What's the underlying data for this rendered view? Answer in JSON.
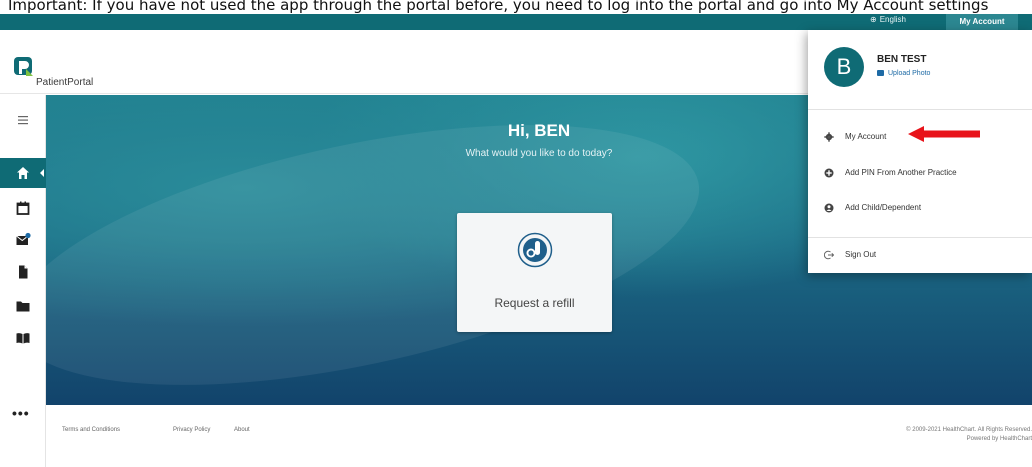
{
  "top_caption": "Important: If you have not used the app through the portal before, you need to log into the portal and go into My Account settings",
  "utility_bar": {
    "language": "English",
    "my_account": "My Account"
  },
  "brand": {
    "name": "PatientPortal"
  },
  "sidebar": {
    "items": [
      {
        "icon": "menu-icon"
      },
      {
        "icon": "home-icon",
        "active": true
      },
      {
        "icon": "calendar-icon"
      },
      {
        "icon": "mail-icon",
        "badge": true
      },
      {
        "icon": "document-icon"
      },
      {
        "icon": "folder-icon"
      },
      {
        "icon": "book-icon"
      }
    ],
    "more": "•••"
  },
  "hero": {
    "greeting": "Hi, BEN",
    "subtitle": "What would you like to do today?",
    "card_label": "Request a refill"
  },
  "footer": {
    "links": [
      "Terms and Conditions",
      "Privacy Policy",
      "About"
    ],
    "copyright": "© 2009-2021 HealthChart. All Rights Reserved.",
    "powered": "Powered by HealthChart"
  },
  "account_menu": {
    "avatar_letter": "B",
    "user_name": "BEN TEST",
    "upload_photo": "Upload Photo",
    "items": [
      {
        "label": "My Account",
        "icon": "gear-icon"
      },
      {
        "label": "Add PIN From Another Practice",
        "icon": "plus-circle-icon"
      },
      {
        "label": "Add Child/Dependent",
        "icon": "person-circle-icon"
      }
    ],
    "sign_out": "Sign Out"
  },
  "colors": {
    "brand_teal": "#0f6b75",
    "annotation_red": "#e8131a",
    "link_blue": "#1d6aa5"
  }
}
